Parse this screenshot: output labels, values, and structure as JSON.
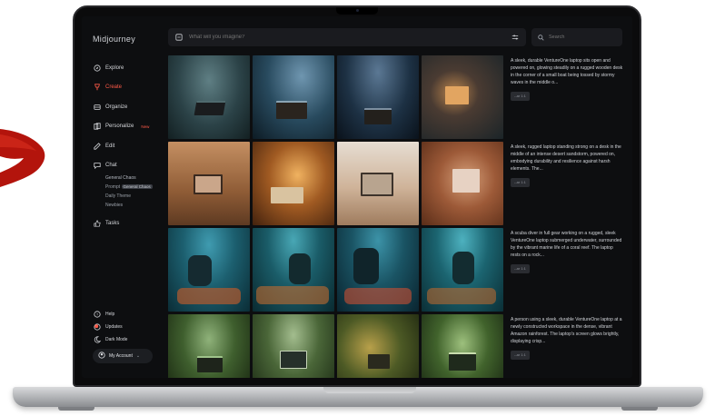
{
  "app": {
    "brand": "Midjourney"
  },
  "colors": {
    "accent": "#ff5a48",
    "arrow": "#b3140c",
    "background": "#0d0e10"
  },
  "sidebar": {
    "items": [
      {
        "label": "Explore",
        "icon": "compass-icon"
      },
      {
        "label": "Create",
        "icon": "brush-icon",
        "active": true
      },
      {
        "label": "Organize",
        "icon": "folder-icon"
      },
      {
        "label": "Personalize",
        "icon": "layers-icon",
        "badge": "New"
      },
      {
        "label": "Edit",
        "icon": "edit-icon"
      },
      {
        "label": "Chat",
        "icon": "chat-icon"
      }
    ],
    "chat_rooms": [
      "General Chaos",
      "Prompt",
      "Daily Theme",
      "Newbies"
    ],
    "chat_tooltip": "General Chaos",
    "tasks": {
      "label": "Tasks",
      "icon": "thumbs-up-icon"
    },
    "bottom": [
      {
        "label": "Help",
        "icon": "help-icon"
      },
      {
        "label": "Updates",
        "icon": "updates-icon"
      },
      {
        "label": "Dark Mode",
        "icon": "moon-icon"
      }
    ],
    "account": {
      "label": "My Account",
      "icon": "avatar-icon"
    }
  },
  "topbar": {
    "prompt_placeholder": "What will you imagine?",
    "search_placeholder": "Search"
  },
  "prompts": [
    {
      "text": "A sleek, durable VentureOne laptop sits open and powered on, glowing steadily on a rugged wooden desk in the corner of a small boat being tossed by stormy waves in the middle o...",
      "tag": "--ar 1:1"
    },
    {
      "text": "A sleek, rugged laptop standing strong on a desk in the middle of an intense desert sandstorm, powered on, embodying durability and resilience against harsh elements. The...",
      "tag": "--ar 1:1"
    },
    {
      "text": "A scuba diver in full gear working on a rugged, sleek VentureOne laptop submerged underwater, surrounded by the vibrant marine life of a coral reef. The laptop rests on a rock...",
      "tag": "--ar 1:1"
    },
    {
      "text": "A person using a sleek, durable VentureOne laptop at a newly constructed workspace in the dense, vibrant Amazon rainforest. The laptop's screen glows brightly, displaying crisp...",
      "tag": "--ar 1:1"
    }
  ]
}
